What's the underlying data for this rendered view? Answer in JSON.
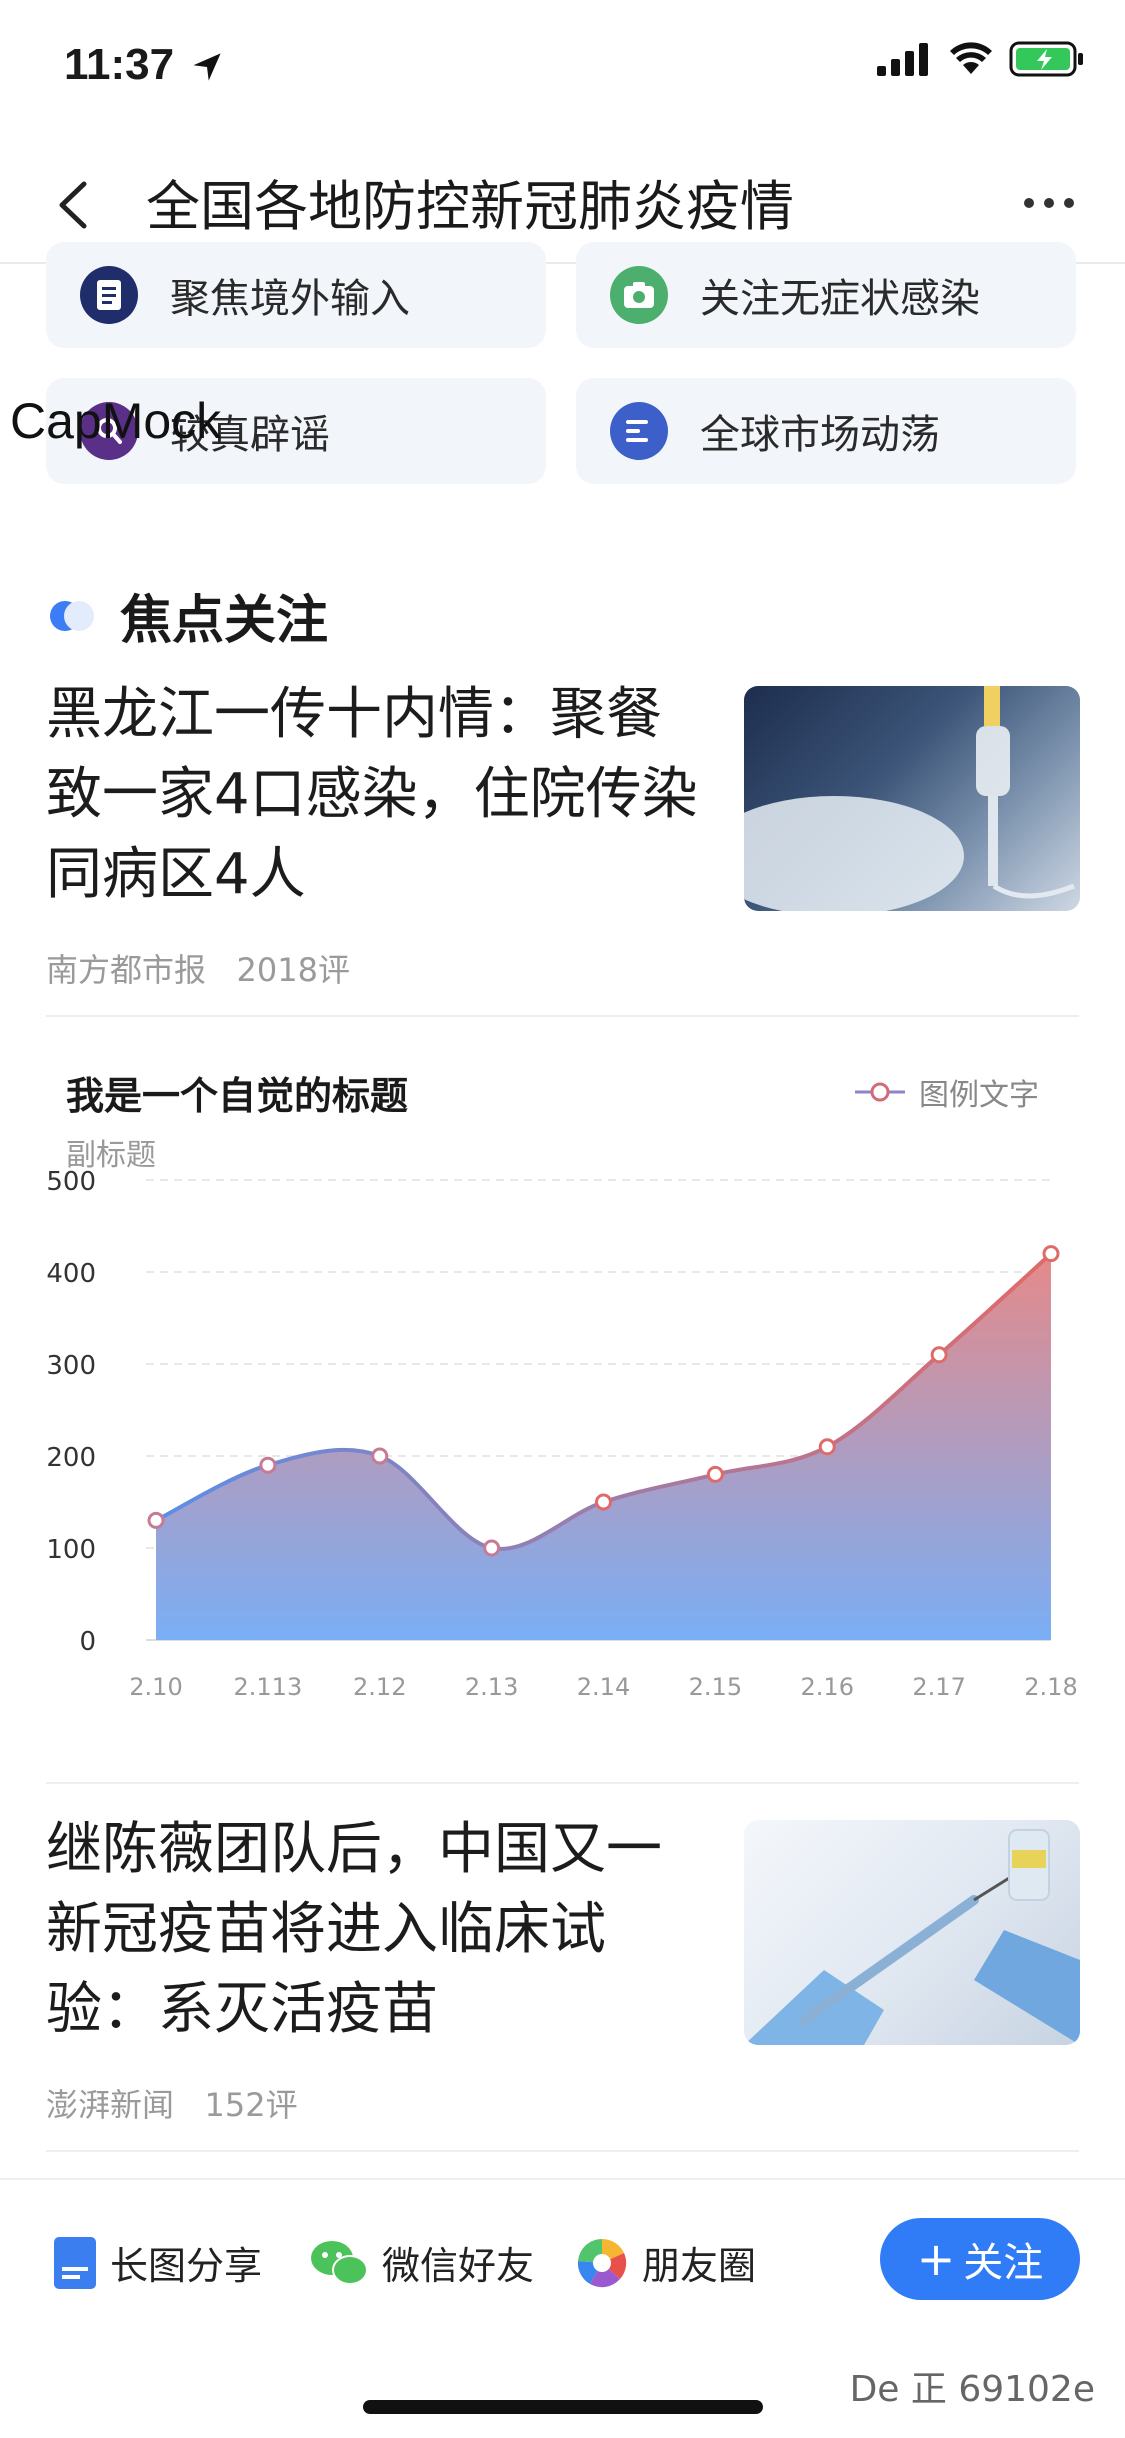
{
  "status_bar": {
    "time": "11:37"
  },
  "nav": {
    "title": "全国各地防控新冠肺炎疫情"
  },
  "categories": [
    {
      "label": "聚焦境外输入",
      "icon": "document-icon",
      "color": "#1f2d6b"
    },
    {
      "label": "关注无症状感染",
      "icon": "camera-icon",
      "color": "#4caf6e"
    },
    {
      "label": "较真辟谣",
      "icon": "magnifier-icon",
      "color": "#5a2f87"
    },
    {
      "label": "全球市场动荡",
      "icon": "list-icon",
      "color": "#3d5fc9"
    }
  ],
  "watermark": "CapMock",
  "focus": {
    "title": "焦点关注"
  },
  "news": [
    {
      "title": "黑龙江一传十内情：聚餐致一家4口感染，住院传染同病区4人",
      "source": "南方都市报",
      "comments": "2018评"
    },
    {
      "title": "继陈薇团队后，中国又一新冠疫苗将进入临床试验：系灭活疫苗",
      "source": "澎湃新闻",
      "comments": "152评"
    }
  ],
  "chart_data": {
    "type": "area",
    "title": "我是一个自觉的标题",
    "subtitle": "副标题",
    "legend": "图例文字",
    "categories": [
      "2.10",
      "2.113",
      "2.12",
      "2.13",
      "2.14",
      "2.15",
      "2.16",
      "2.17",
      "2.18"
    ],
    "values": [
      130,
      190,
      200,
      100,
      150,
      180,
      210,
      310,
      420
    ],
    "y_ticks": [
      "0",
      "100",
      "200",
      "300",
      "400",
      "500"
    ],
    "ylim": [
      0,
      500
    ],
    "colors": {
      "line_start": "#5b8ee6",
      "line_end": "#e06a6a",
      "fill_top": "#e58a8a",
      "fill_bottom": "#7aaef5"
    }
  },
  "bottom_bar": {
    "share_long_image": "长图分享",
    "share_wechat": "微信好友",
    "share_moments": "朋友圈",
    "follow": "关注",
    "footer_code": "De 正 69102e"
  }
}
